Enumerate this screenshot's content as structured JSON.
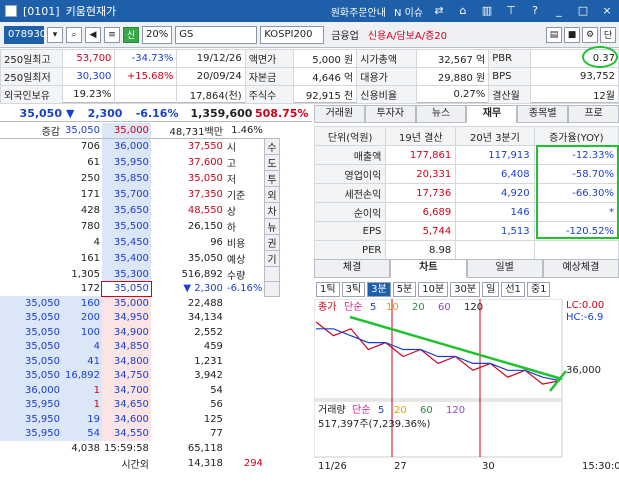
{
  "window": {
    "code_label": "[0101]",
    "title": "키움현재가",
    "right_links": [
      "원화주문안내",
      "N 이슈"
    ]
  },
  "toolbar": {
    "stock_code": "078930",
    "badge": "신",
    "ratio": "20%",
    "name": "GS",
    "market": "KOSPI200",
    "sector": "금융업",
    "credit": "신용A/담보A/증20",
    "button_right": "단"
  },
  "info": {
    "rows": [
      [
        {
          "t": "250일최고",
          "c": "k"
        },
        {
          "t": "53,700",
          "c": "r"
        },
        {
          "t": "-34.73%",
          "c": "b"
        },
        {
          "t": "19/12/26",
          "c": "k"
        },
        {
          "t": "액면가",
          "c": "k"
        },
        {
          "t": "5,000 원",
          "c": "k"
        },
        {
          "t": "시가총액",
          "c": "k"
        },
        {
          "t": "32,567 억",
          "c": "k"
        },
        {
          "t": "PBR",
          "c": "k"
        },
        {
          "t": "0.37",
          "c": "k"
        }
      ],
      [
        {
          "t": "250일최저",
          "c": "k"
        },
        {
          "t": "30,300",
          "c": "b"
        },
        {
          "t": "+15.68%",
          "c": "r"
        },
        {
          "t": "20/09/24",
          "c": "k"
        },
        {
          "t": "자본금",
          "c": "k"
        },
        {
          "t": "4,646 억",
          "c": "k"
        },
        {
          "t": "대용가",
          "c": "k"
        },
        {
          "t": "29,880 원",
          "c": "k"
        },
        {
          "t": "BPS",
          "c": "k"
        },
        {
          "t": "93,752",
          "c": "k"
        }
      ],
      [
        {
          "t": "외국인보유",
          "c": "k"
        },
        {
          "t": "19.23%",
          "c": "k"
        },
        {
          "t": "",
          "c": "k"
        },
        {
          "t": "17,864(천)",
          "c": "k"
        },
        {
          "t": "주식수",
          "c": "k"
        },
        {
          "t": "92,915 천",
          "c": "k"
        },
        {
          "t": "신용비율",
          "c": "k"
        },
        {
          "t": "0.27%",
          "c": "k"
        },
        {
          "t": "결산월",
          "c": "k"
        },
        {
          "t": "12월",
          "c": "k"
        }
      ]
    ]
  },
  "price": {
    "current": "35,050",
    "arrow": "▼",
    "change": "2,300",
    "rate": "-6.16%",
    "volume": "1,359,600",
    "vol_rate": "508.75%"
  },
  "orderbook": {
    "head": [
      "증감",
      "35,050",
      "35,000",
      "48,731백만",
      "1.46%"
    ],
    "asks": [
      [
        "706",
        "36,000",
        "37,550",
        "시"
      ],
      [
        "61",
        "35,950",
        "37,600",
        "고"
      ],
      [
        "250",
        "35,850",
        "35,050",
        "저"
      ],
      [
        "171",
        "35,700",
        "37,350",
        "기준"
      ],
      [
        "428",
        "35,650",
        "48,550",
        "상"
      ],
      [
        "780",
        "35,500",
        "26,150",
        "하"
      ],
      [
        "4",
        "35,450",
        "96",
        "비용"
      ],
      [
        "161",
        "35,400",
        "35,050",
        "예상"
      ],
      [
        "1,305",
        "35,300",
        "516,892",
        "수량"
      ],
      [
        "172",
        "35,050",
        "▼ 2,300",
        "-6.16%"
      ]
    ],
    "side_tabs": [
      "수",
      "도",
      "투",
      "외",
      "차",
      "뉴",
      "권",
      "기"
    ],
    "bids": [
      [
        "35,050",
        "160",
        "35,000",
        "22,488"
      ],
      [
        "35,050",
        "200",
        "34,950",
        "34,134"
      ],
      [
        "35,050",
        "100",
        "34,900",
        "2,552"
      ],
      [
        "35,050",
        "4",
        "34,850",
        "459"
      ],
      [
        "35,050",
        "41",
        "34,800",
        "1,231"
      ],
      [
        "35,050",
        "16,892",
        "34,750",
        "3,942"
      ],
      [
        "36,000",
        "1",
        "34,700",
        "54"
      ],
      [
        "35,950",
        "1",
        "34,650",
        "56"
      ],
      [
        "35,950",
        "19",
        "34,600",
        "125"
      ],
      [
        "35,950",
        "54",
        "34,550",
        "77"
      ]
    ],
    "footer": [
      "4,038",
      "15:59:58",
      "65,118",
      "시간외",
      "14,318",
      "294"
    ]
  },
  "fin_tabs": [
    "거래원",
    "투자자",
    "뉴스",
    "재무",
    "종목별",
    "프로"
  ],
  "fin": {
    "headers": [
      "단위(억원)",
      "19년 결산",
      "20년 3분기",
      "증가율(YOY)"
    ],
    "rows": [
      [
        "매출액",
        "177,861",
        "117,913",
        "-12.33%"
      ],
      [
        "영업이익",
        "20,331",
        "6,408",
        "-58.70%"
      ],
      [
        "세전손익",
        "17,736",
        "4,920",
        "-66.30%"
      ],
      [
        "순이익",
        "6,689",
        "146",
        "*"
      ],
      [
        "EPS",
        "5,744",
        "1,513",
        "-120.52%"
      ],
      [
        "PER",
        "8.98",
        "",
        ""
      ]
    ]
  },
  "chart_tabs": [
    "체결",
    "차트",
    "일별",
    "예상체결"
  ],
  "chart_tools": [
    "1틱",
    "3틱",
    "3분",
    "5분",
    "10분",
    "30분",
    "일",
    "선1",
    "중1"
  ],
  "chart_data": {
    "type": "line",
    "legend_price": [
      "종가",
      "단순",
      "5",
      "10",
      "20",
      "60",
      "120"
    ],
    "lc": "LC:0.00",
    "hc": "HC:-6.9",
    "yaxis": "36,000",
    "legend_vol": [
      "거래량",
      "단순",
      "5",
      "20",
      "60",
      "120"
    ],
    "vol_text": "517,397주(7,239.36%)",
    "x_labels": [
      "11/26",
      "27",
      "30",
      "15:30:0"
    ],
    "series": [
      {
        "name": "종가",
        "values": [
          35.9,
          35.7,
          35.8,
          35.5,
          35.6,
          35.4,
          35.5,
          35.3,
          35.4,
          35.2,
          35.3,
          35.1,
          35.2,
          35.0,
          35.05
        ]
      },
      {
        "name": "5",
        "values": [
          35.8,
          35.8,
          35.7,
          35.6,
          35.6,
          35.5,
          35.5,
          35.4,
          35.4,
          35.3,
          35.3,
          35.2,
          35.2,
          35.1,
          35.05
        ]
      }
    ]
  }
}
